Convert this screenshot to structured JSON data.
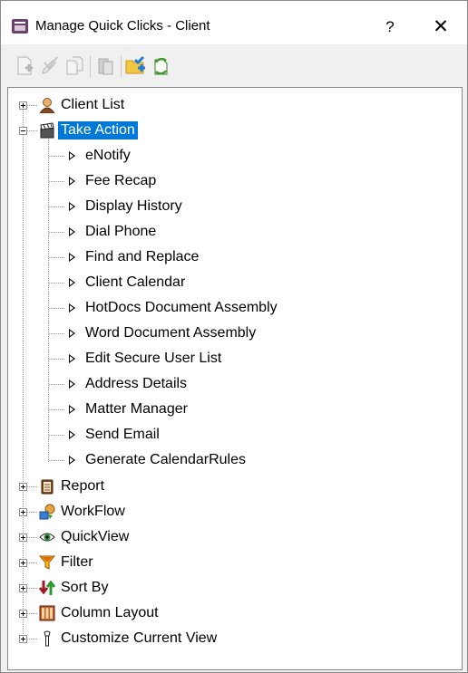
{
  "window": {
    "title": "Manage Quick Clicks - Client",
    "help_label": "?",
    "close_label": "✕"
  },
  "toolbar": {
    "buttons": [
      {
        "name": "new-item-icon",
        "enabled": false
      },
      {
        "name": "edit-item-icon",
        "enabled": false
      },
      {
        "name": "copy-item-icon",
        "enabled": false
      },
      {
        "name": "delete-item-icon",
        "enabled": false
      },
      {
        "name": "add-folder-icon",
        "enabled": true
      },
      {
        "name": "refresh-icon",
        "enabled": true
      }
    ]
  },
  "tree": {
    "client_list": {
      "label": "Client List",
      "icon": "client-person-icon"
    },
    "take_action": {
      "label": "Take Action",
      "icon": "clapperboard-icon",
      "children": [
        "eNotify",
        "Fee Recap",
        "Display History",
        "Dial Phone",
        "Find and Replace",
        "Client Calendar",
        "HotDocs Document Assembly",
        "Word Document Assembly",
        "Edit Secure User List",
        "Address Details",
        "Matter Manager",
        "Send Email",
        "Generate CalendarRules"
      ]
    },
    "report": {
      "label": "Report",
      "icon": "report-icon"
    },
    "workflow": {
      "label": "WorkFlow",
      "icon": "workflow-icon"
    },
    "quickview": {
      "label": "QuickView",
      "icon": "eye-icon"
    },
    "filter": {
      "label": "Filter",
      "icon": "funnel-icon"
    },
    "sort_by": {
      "label": "Sort By",
      "icon": "sort-arrows-icon"
    },
    "column_layout": {
      "label": "Column Layout",
      "icon": "columns-icon"
    },
    "customize": {
      "label": "Customize Current View",
      "icon": "wrench-icon"
    }
  },
  "colors": {
    "selection": "#0078d7",
    "title_icon": "#6d3f6d"
  }
}
